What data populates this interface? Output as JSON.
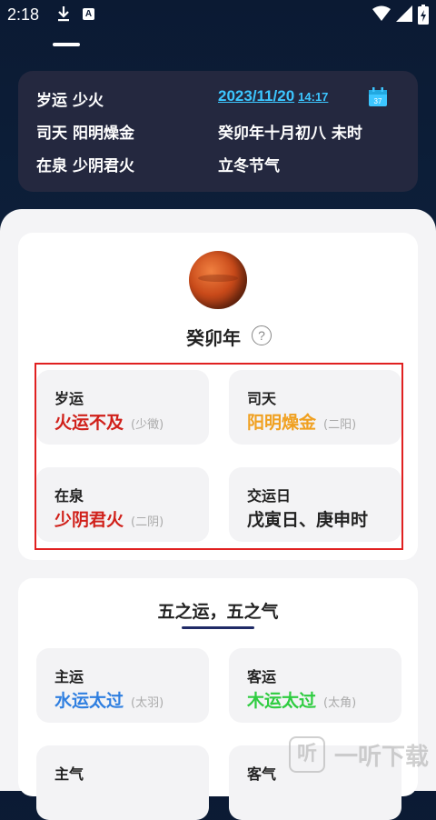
{
  "status_bar": {
    "time": "2:18",
    "notification_letter": "A",
    "icons": [
      "download-icon",
      "a-icon",
      "wifi-icon",
      "signal-icon",
      "battery-icon"
    ]
  },
  "info_card": {
    "suiyun": {
      "label": "岁运",
      "value": "少火"
    },
    "sitian": {
      "label": "司天",
      "value": "阳明燥金"
    },
    "zaiquan": {
      "label": "在泉",
      "value": "少阴君火"
    },
    "date": "2023/11/20",
    "time": "14:17",
    "calendar_day": "37",
    "lunar_date": "癸卯年十月初八 未时",
    "solar_term": "立冬节气"
  },
  "year_section": {
    "title": "癸卯年",
    "help": "?"
  },
  "tiles": {
    "suiyun": {
      "label": "岁运",
      "value": "火运不及",
      "sub": "(少徵)",
      "color": "#d0201a"
    },
    "sitian": {
      "label": "司天",
      "value": "阳明燥金",
      "sub": "(二阳)",
      "color": "#f0a020"
    },
    "zaiquan": {
      "label": "在泉",
      "value": "少阴君火",
      "sub": "(二阴)",
      "color": "#d0201a"
    },
    "jiaoyun": {
      "label": "交运日",
      "value": "戊寅日、庚申时",
      "color": "#222222"
    }
  },
  "section2": {
    "title": "五之运，五之气",
    "zhuyun": {
      "label": "主运",
      "value": "水运太过",
      "sub": "(太羽)",
      "color": "#2f7fe0"
    },
    "keyun": {
      "label": "客运",
      "value": "木运太过",
      "sub": "(太角)",
      "color": "#2ecc40"
    },
    "zhuqi": {
      "label": "主气"
    },
    "keqi": {
      "label": "客气"
    }
  },
  "watermark": {
    "logo": "听",
    "text": "一听下载"
  }
}
